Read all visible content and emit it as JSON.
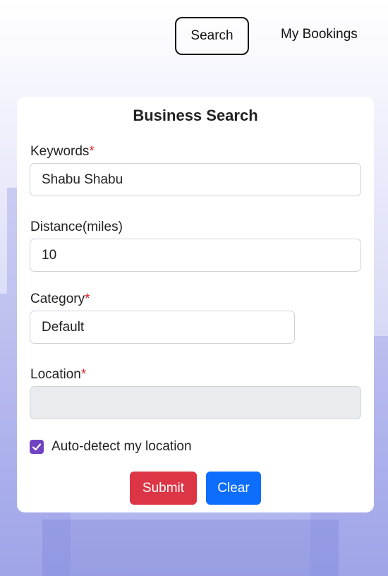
{
  "nav": {
    "search_label": "Search",
    "bookings_label": "My Bookings"
  },
  "form": {
    "title": "Business Search",
    "required_marker": "*",
    "keywords": {
      "label": "Keywords",
      "value": "Shabu Shabu"
    },
    "distance": {
      "label": "Distance(miles)",
      "value": "10"
    },
    "category": {
      "label": "Category",
      "value": "Default"
    },
    "location": {
      "label": "Location",
      "value": ""
    },
    "auto_detect": {
      "label": "Auto-detect my location",
      "checked": true
    },
    "submit_label": "Submit",
    "clear_label": "Clear"
  },
  "colors": {
    "submit": "#dc3545",
    "clear": "#0d6efd",
    "checkbox": "#6f42c1",
    "required": "#e0212b"
  }
}
